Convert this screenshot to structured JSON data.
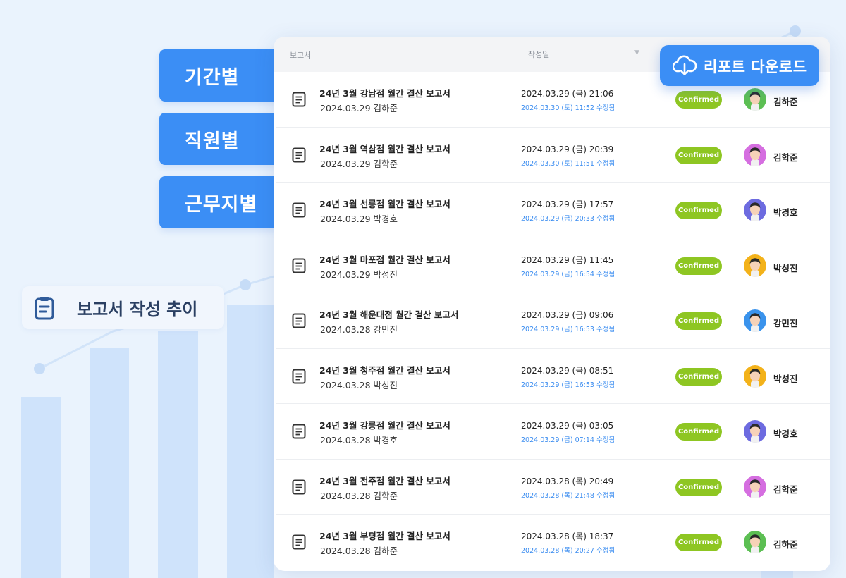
{
  "filters": [
    "기간별",
    "직원별",
    "근무지별"
  ],
  "trend_label": "보고서 작성 추이",
  "download_button": {
    "label": "리포트 다운로드",
    "icon": "cloud-download-icon"
  },
  "table": {
    "headers": {
      "report": "보고서",
      "created_date": "작성일"
    },
    "rows": [
      {
        "title": "24년 3월 강남점 월간 결산 보고서",
        "meta": "2024.03.29 김하준",
        "created": "2024.03.29 (금) 21:06",
        "edited": "2024.03.30 (토) 11:52 수정됨",
        "status": "Confirmed",
        "user": "김하준",
        "avatar_color": "#5cbf53"
      },
      {
        "title": "24년 3월 역삼점 월간 결산 보고서",
        "meta": "2024.03.29 김학준",
        "created": "2024.03.29 (금) 20:39",
        "edited": "2024.03.30 (토) 11:51 수정됨",
        "status": "Confirmed",
        "user": "김학준",
        "avatar_color": "#d56ee0"
      },
      {
        "title": "24년 3월 선릉점 월간 결산 보고서",
        "meta": "2024.03.29 박경호",
        "created": "2024.03.29 (금) 17:57",
        "edited": "2024.03.29 (금) 20:33 수정됨",
        "status": "Confirmed",
        "user": "박경호",
        "avatar_color": "#6d6be0"
      },
      {
        "title": "24년 3월 마포점 월간 결산 보고서",
        "meta": "2024.03.29 박성진",
        "created": "2024.03.29 (금) 11:45",
        "edited": "2024.03.29 (금) 16:54 수정됨",
        "status": "Confirmed",
        "user": "박성진",
        "avatar_color": "#f3b21a"
      },
      {
        "title": "24년 3월 해운대점 월간 결산 보고서",
        "meta": "2024.03.28 강민진",
        "created": "2024.03.29 (금) 09:06",
        "edited": "2024.03.29 (금) 16:53 수정됨",
        "status": "Confirmed",
        "user": "강민진",
        "avatar_color": "#3a93ec"
      },
      {
        "title": "24년 3월 청주점 월간 결산 보고서",
        "meta": "2024.03.28 박성진",
        "created": "2024.03.29 (금) 08:51",
        "edited": "2024.03.29 (금) 16:53 수정됨",
        "status": "Confirmed",
        "user": "박성진",
        "avatar_color": "#f3b21a"
      },
      {
        "title": "24년 3월 강릉점 월간 결산 보고서",
        "meta": "2024.03.28 박경호",
        "created": "2024.03.29 (금) 03:05",
        "edited": "2024.03.29 (금) 07:14 수정됨",
        "status": "Confirmed",
        "user": "박경호",
        "avatar_color": "#6d6be0"
      },
      {
        "title": "24년 3월 전주점 월간 결산 보고서",
        "meta": "2024.03.28 김학준",
        "created": "2024.03.28 (목) 20:49",
        "edited": "2024.03.28 (목) 21:48 수정됨",
        "status": "Confirmed",
        "user": "김학준",
        "avatar_color": "#d56ee0"
      },
      {
        "title": "24년 3월 부평점 월간 결산 보고서",
        "meta": "2024.03.28 김하준",
        "created": "2024.03.28 (목) 18:37",
        "edited": "2024.03.28 (목) 20:27 수정됨",
        "status": "Confirmed",
        "user": "김하준",
        "avatar_color": "#5cbf53"
      }
    ]
  },
  "colors": {
    "accent": "#3b8ef5",
    "confirmed": "#8ec622",
    "edited_text": "#3a8cf0"
  }
}
